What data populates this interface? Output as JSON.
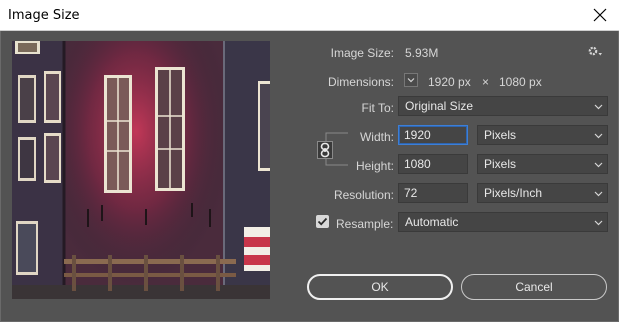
{
  "window": {
    "title": "Image Size"
  },
  "info": {
    "image_size_label": "Image Size:",
    "image_size_value": "5.93M",
    "dimensions_label": "Dimensions:",
    "dimensions_width": "1920 px",
    "dimensions_sep": "×",
    "dimensions_height": "1080 px"
  },
  "fit_to": {
    "label": "Fit To:",
    "value": "Original Size"
  },
  "width": {
    "label": "Width:",
    "value": "1920",
    "unit": "Pixels"
  },
  "height": {
    "label": "Height:",
    "value": "1080",
    "unit": "Pixels"
  },
  "resolution": {
    "label": "Resolution:",
    "value": "72",
    "unit": "Pixels/Inch"
  },
  "resample": {
    "label": "Resample:",
    "value": "Automatic",
    "checked": true
  },
  "buttons": {
    "ok": "OK",
    "cancel": "Cancel"
  },
  "colors": {
    "background": "#535353",
    "field": "#454545",
    "focus": "#3d7fd6",
    "text": "#d6d6d6"
  },
  "icons": {
    "close": "close-icon",
    "gear": "gear-icon",
    "link": "link-chain-icon",
    "chevron": "chevron-down-icon",
    "check": "checkmark-icon"
  }
}
